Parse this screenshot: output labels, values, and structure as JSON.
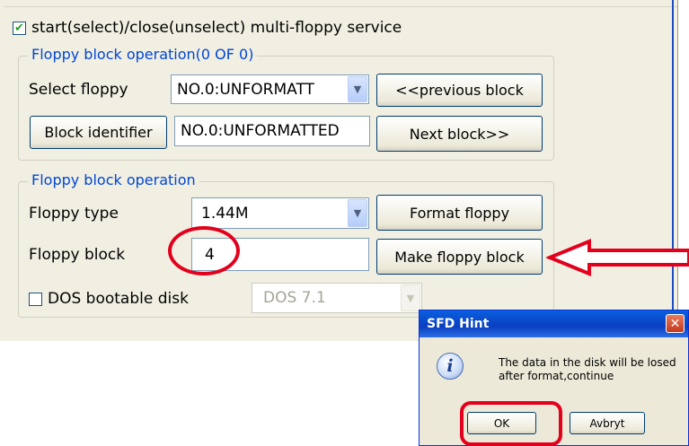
{
  "service": {
    "checked": true,
    "label": "start(select)/close(unselect) multi-floppy service"
  },
  "block_group": {
    "legend": "Floppy block operation(0 OF 0)",
    "select_floppy_label": "Select floppy",
    "select_floppy_value": "NO.0:UNFORMATT",
    "previous_button": "<<previous block",
    "block_identifier_button": "Block identifier",
    "block_identifier_value": "NO.0:UNFORMATTED",
    "next_button": "Next block>>"
  },
  "op_group": {
    "legend": "Floppy block operation",
    "floppy_type_label": "Floppy type",
    "floppy_type_value": "1.44M",
    "format_button": "Format floppy",
    "floppy_block_label": "Floppy block",
    "floppy_block_value": "4",
    "make_button": "Make floppy block",
    "dos_checkbox_checked": false,
    "dos_label": "DOS bootable disk",
    "dos_version_value": "DOS 7.1"
  },
  "dialog": {
    "title": "SFD Hint",
    "message_line1": "The data in the disk will be losed",
    "message_line2": "after format,continue",
    "ok_button": "OK",
    "cancel_button": "Avbryt"
  },
  "colors": {
    "annotation": "#e3001c",
    "legend": "#0046d5",
    "panel_bg": "#f1efe2"
  },
  "icons": [
    "checkbox-checked-icon",
    "chevron-down-icon",
    "info-icon",
    "close-icon",
    "red-arrow-icon"
  ]
}
